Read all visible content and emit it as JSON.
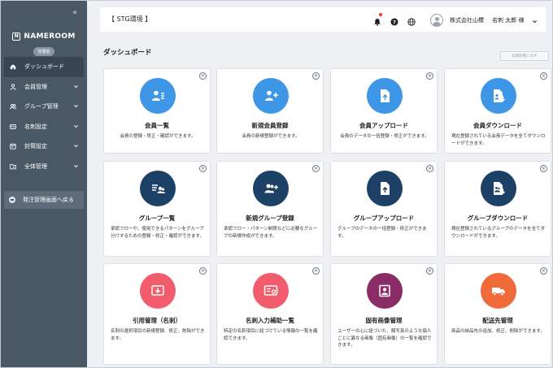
{
  "sidebar": {
    "logo": "NAMEROOM",
    "badge": "管理者",
    "items": [
      {
        "label": "ダッシュボード"
      },
      {
        "label": "会員管理"
      },
      {
        "label": "グループ管理"
      },
      {
        "label": "名刺設定"
      },
      {
        "label": "封筒設定"
      },
      {
        "label": "全体管理"
      }
    ],
    "back_label": "発注管理画面へ戻る"
  },
  "header": {
    "env": "【 STG環境 】",
    "company": "株式会社山櫻",
    "user": "名刺 太郎 様"
  },
  "page": {
    "title": "ダッシュボード",
    "reset_label": "初期状態に戻す"
  },
  "cards": [
    {
      "title": "会員一覧",
      "desc": "会員の登録・修正・確認ができます。",
      "color": "#3d97e6",
      "icon": "member-list-icon"
    },
    {
      "title": "新規会員登録",
      "desc": "会員の新規登録ができます。",
      "color": "#3d97e6",
      "icon": "member-add-icon"
    },
    {
      "title": "会員アップロード",
      "desc": "会員のデータの一括登録・修正ができます。",
      "color": "#3d97e6",
      "icon": "file-upload-icon"
    },
    {
      "title": "会員ダウンロード",
      "desc": "現在登録されている会員データを全てダウンロードができます。",
      "color": "#3d97e6",
      "icon": "file-download-icon"
    },
    {
      "title": "グループ一覧",
      "desc": "承認フローや、使用できるパターンをグループ分けするための登録・修正・確認ができます。",
      "color": "#1d4066",
      "icon": "group-list-icon"
    },
    {
      "title": "新規グループ登録",
      "desc": "承認フロー・パターン制限などに必要なグループの新規作成ができます。",
      "color": "#1d4066",
      "icon": "group-add-icon"
    },
    {
      "title": "グループアップロード",
      "desc": "グループのデータの一括登録・修正ができます。",
      "color": "#1d4066",
      "icon": "file-upload-icon"
    },
    {
      "title": "グループダウンロード",
      "desc": "現在登録されているグループのデータを全てダウンロードができます。",
      "color": "#1d4066",
      "icon": "file-download-icon"
    },
    {
      "title": "引用管理（名刺）",
      "desc": "名刺の選択項目の新規登録、修正、削除ができます。",
      "color": "#f25d6d",
      "icon": "quote-icon"
    },
    {
      "title": "名刺入力補助一覧",
      "desc": "特定の名刺項目に紐づけている情報の一覧を確認できます。",
      "color": "#f25d6d",
      "icon": "card-assist-icon"
    },
    {
      "title": "固有画像管理",
      "desc": "ユーザーの心に紐づいた、顔写真のような個人ごとに異なる画像（固有画像）の一覧を確認できます。",
      "color": "#8a2d66",
      "icon": "portrait-icon"
    },
    {
      "title": "配送先管理",
      "desc": "商品の納品先の追加、修正、削除ができます。",
      "color": "#f06a3a",
      "icon": "truck-icon"
    }
  ]
}
